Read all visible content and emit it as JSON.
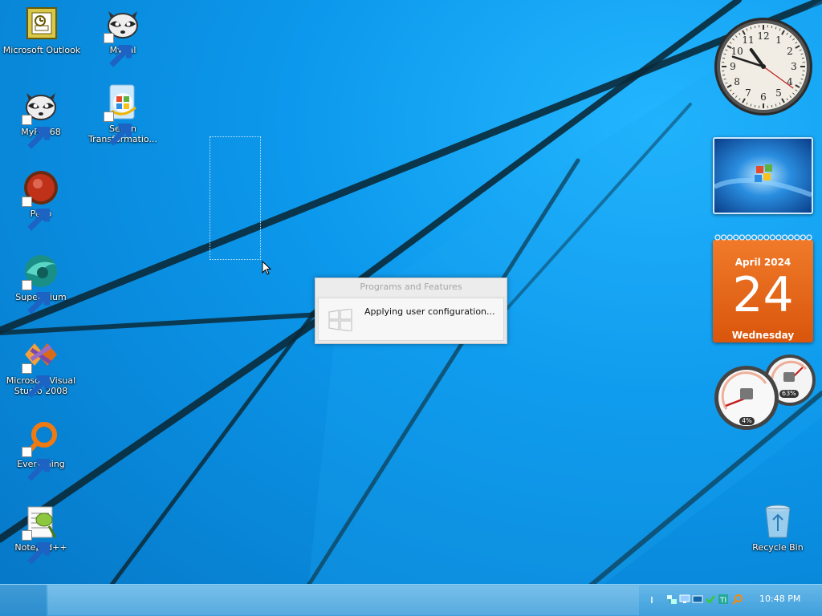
{
  "desktop": {
    "icons": [
      {
        "label": "Microsoft Outlook",
        "icon": "outlook-icon"
      },
      {
        "label": "Mypal",
        "icon": "mypal-raccoon-icon"
      },
      {
        "label": "MyPal 68",
        "icon": "mypal-raccoon-icon"
      },
      {
        "label": "Seven Transformatio...",
        "icon": "seven-transformation-icon"
      },
      {
        "label": "Pego",
        "icon": "pego-icon"
      },
      {
        "label": "Supermium",
        "icon": "supermium-icon"
      },
      {
        "label": "Microsoft Visual Studio 2008",
        "icon": "visual-studio-icon"
      },
      {
        "label": "Everything",
        "icon": "everything-search-icon"
      },
      {
        "label": "Notepad++",
        "icon": "notepad-plus-plus-icon"
      },
      {
        "label": "Recycle Bin",
        "icon": "recycle-bin-icon"
      }
    ]
  },
  "dialog": {
    "title": "Programs and Features",
    "message": "Applying user configuration..."
  },
  "gadgets": {
    "clock": {
      "hour": 10,
      "minute": 48,
      "numerals": [
        "12",
        "1",
        "2",
        "3",
        "4",
        "5",
        "6",
        "7",
        "8",
        "9",
        "10",
        "11"
      ]
    },
    "calendar": {
      "month": "April 2024",
      "day": "24",
      "weekday": "Wednesday"
    },
    "meters": {
      "cpu": "4%",
      "memory": "63%"
    }
  },
  "taskbar": {
    "time": "10:48 PM",
    "tray_icons": [
      "network-icon",
      "display-icon",
      "monitor-icon",
      "security-check-icon",
      "ti-app-icon",
      "search-icon"
    ]
  },
  "colors": {
    "wallpaper_blue": "#0c98ec",
    "taskbar": "#4aa6df",
    "calendar_orange": "#e8661b"
  }
}
